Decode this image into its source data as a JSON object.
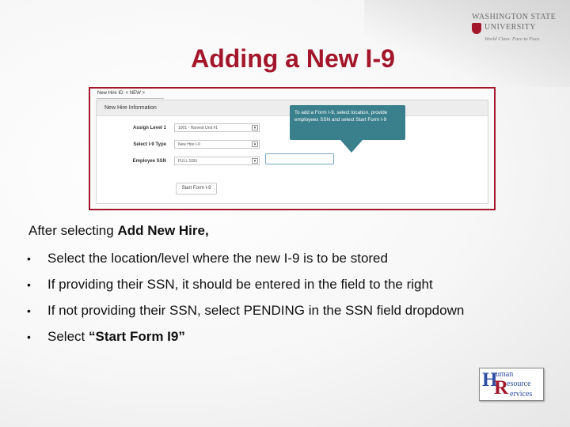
{
  "slide": {
    "title": "Adding a New I-9"
  },
  "logo_wsu": {
    "line1": "WASHINGTON STATE",
    "line2": "UNIVERSITY",
    "tagline": "World Class. Face to Face.",
    "accent_color": "#a3162b"
  },
  "screenshot": {
    "breadcrumb": "New Hire ID: < NEW >",
    "section_title": "New Hire Information",
    "fields": [
      {
        "label": "Assign Level 1",
        "value": "1001 - Harvest Unit #1"
      },
      {
        "label": "Select I-9 Type",
        "value": "New Hire I-9"
      },
      {
        "label": "Employee SSN",
        "value": "FULL SSN"
      }
    ],
    "start_button": "Start Form I-9",
    "tooltip": "To add a Form I-9, select location, provide employees SSN and select Start Form I-9",
    "tooltip_color": "#3a7f8c",
    "chevron_icon": "chevron-down-icon"
  },
  "content": {
    "intro_plain": "After selecting ",
    "intro_bold": "Add New Hire,",
    "bullets": [
      "Select the location/level where the new I-9 is to be stored",
      "If providing their SSN, it should be entered in the field to the right",
      "If not providing their SSN, select PENDING in the SSN field dropdown"
    ],
    "last_bullet_plain": "Select ",
    "last_bullet_bold": "“Start Form I9”"
  },
  "logo_hr": {
    "h": "H",
    "r": "R",
    "word1": "uman",
    "word2": "esource",
    "word3": "ervices"
  }
}
